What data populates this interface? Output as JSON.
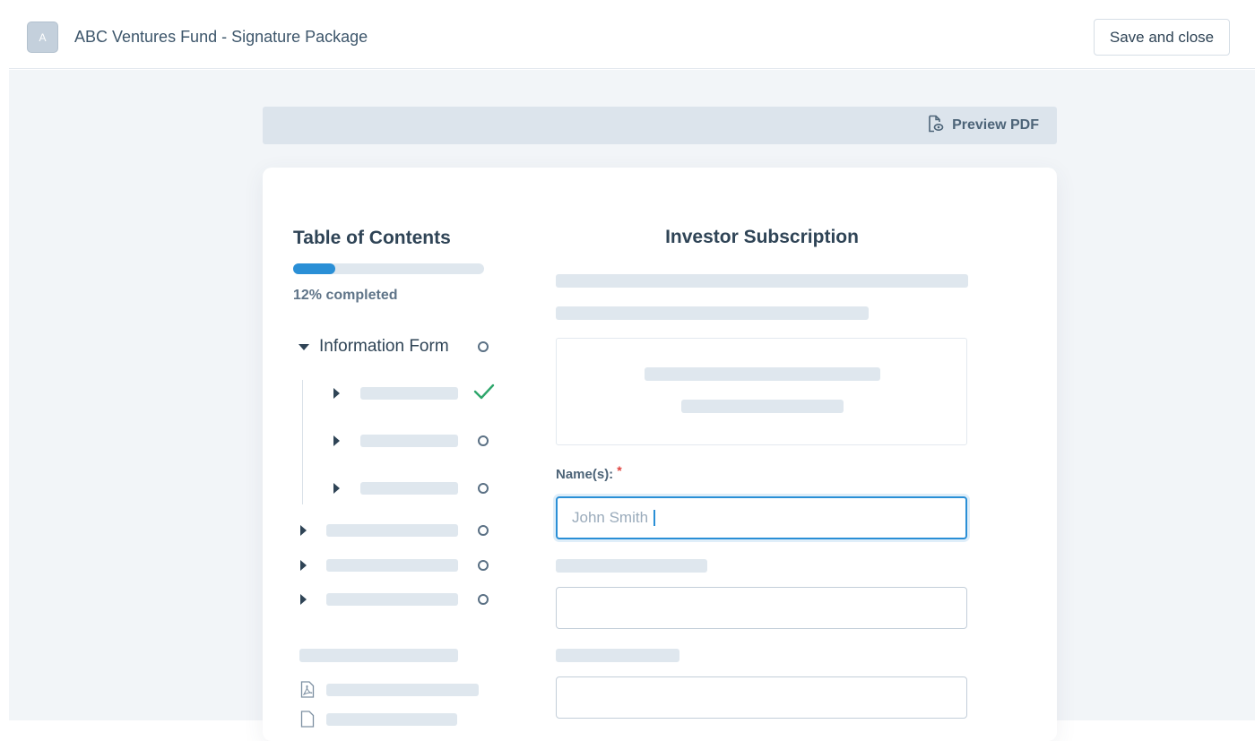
{
  "header": {
    "avatar_letter": "A",
    "title": "ABC Ventures Fund - Signature Package",
    "save_label": "Save and close"
  },
  "toolbar": {
    "preview_label": "Preview PDF",
    "preview_icon": "file-search-icon"
  },
  "toc": {
    "title": "Table of Contents",
    "progress_percent": 12,
    "progress_text": "12% completed",
    "sections": [
      {
        "label": "Information Form",
        "expanded": true,
        "status": "incomplete",
        "children": [
          {
            "status": "complete"
          },
          {
            "status": "incomplete"
          },
          {
            "status": "incomplete"
          }
        ]
      },
      {
        "status": "incomplete"
      },
      {
        "status": "incomplete"
      },
      {
        "status": "incomplete"
      }
    ],
    "documents": [
      {
        "icon": "pdf-file-icon"
      },
      {
        "icon": "pdf-file-icon"
      }
    ]
  },
  "form": {
    "title": "Investor Subscription",
    "name_label": "Name(s):",
    "required_marker": "*",
    "name_value": "John Smith"
  },
  "colors": {
    "accent": "#2a8fd6",
    "complete": "#2ea66b",
    "required": "#e0433f",
    "skeleton": "#dfe7ee"
  }
}
